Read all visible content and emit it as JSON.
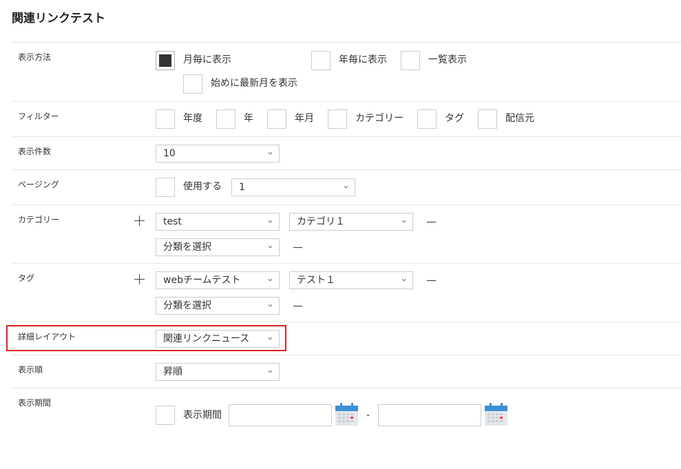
{
  "page": {
    "title": "関連リンクテスト"
  },
  "display_method": {
    "label": "表示方法",
    "options": [
      {
        "label": "月毎に表示",
        "checked": true
      },
      {
        "label": "年毎に表示",
        "checked": false
      },
      {
        "label": "一覧表示",
        "checked": false
      },
      {
        "label": "始めに最新月を表示",
        "checked": false
      }
    ]
  },
  "filter": {
    "label": "フィルター",
    "options": [
      {
        "label": "年度",
        "checked": false
      },
      {
        "label": "年",
        "checked": false
      },
      {
        "label": "年月",
        "checked": false
      },
      {
        "label": "カテゴリー",
        "checked": false
      },
      {
        "label": "タグ",
        "checked": false
      },
      {
        "label": "配信元",
        "checked": false
      }
    ]
  },
  "display_count": {
    "label": "表示件数",
    "value": "10"
  },
  "paging": {
    "label": "ページング",
    "checkbox_label": "使用する",
    "checked": false,
    "value": "1"
  },
  "category": {
    "label": "カテゴリー",
    "rows": [
      {
        "group": "test",
        "item": "カテゴリ１"
      },
      {
        "group": "分類を選択"
      }
    ]
  },
  "tag": {
    "label": "タグ",
    "rows": [
      {
        "group": "webチームテスト",
        "item": "テスト１"
      },
      {
        "group": "分類を選択"
      }
    ]
  },
  "detail_layout": {
    "label": "詳細レイアウト",
    "value": "関連リンクニュース"
  },
  "display_order": {
    "label": "表示順",
    "value": "昇順"
  },
  "display_period": {
    "label": "表示期間",
    "checkbox_label": "表示期間",
    "checked": false,
    "separator": "-",
    "start_value": "",
    "end_value": ""
  },
  "colors": {
    "highlight": "#e02020",
    "calendar_header": "#3a8fd6",
    "calendar_mark": "#e0473e"
  }
}
